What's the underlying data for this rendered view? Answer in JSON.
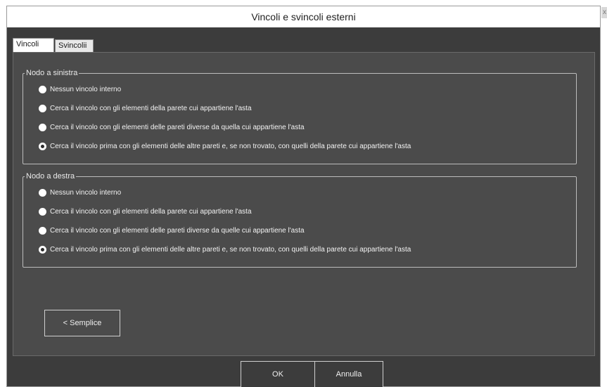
{
  "window": {
    "title": "Vincoli e svincoli esterni",
    "close_label": "x"
  },
  "tabs": [
    {
      "label": "Vincoli",
      "active": true
    },
    {
      "label": "Svincolii",
      "active": false
    }
  ],
  "left_node": {
    "legend": "Nodo a sinistra",
    "options": [
      {
        "label": "Nessun vincolo interno",
        "checked": false
      },
      {
        "label": "Cerca il vincolo con gli elementi della parete cui appartiene l'asta",
        "checked": false
      },
      {
        "label": "Cerca il vincolo con gli elementi delle pareti diverse da quella cui appartiene l'asta",
        "checked": false
      },
      {
        "label": "Cerca il vincolo prima con gli elementi delle altre pareti e, se non trovato, con quelli della parete cui appartiene l'asta",
        "checked": true
      }
    ]
  },
  "right_node": {
    "legend": "Nodo a destra",
    "options": [
      {
        "label": "Nessun vincolo interno",
        "checked": false
      },
      {
        "label": "Cerca il vincolo con gli elementi della parete cui appartiene l'asta",
        "checked": false
      },
      {
        "label": "Cerca il vincolo con gli elementi delle pareti diverse da quelle cui appartiene l'asta",
        "checked": false
      },
      {
        "label": "Cerca il vincolo prima con gli elementi delle altre pareti e, se non trovato, con quelli della parete cui appartiene l'asta",
        "checked": true
      }
    ]
  },
  "buttons": {
    "simple": "< Semplice",
    "ok": "OK",
    "cancel": "Annulla"
  }
}
